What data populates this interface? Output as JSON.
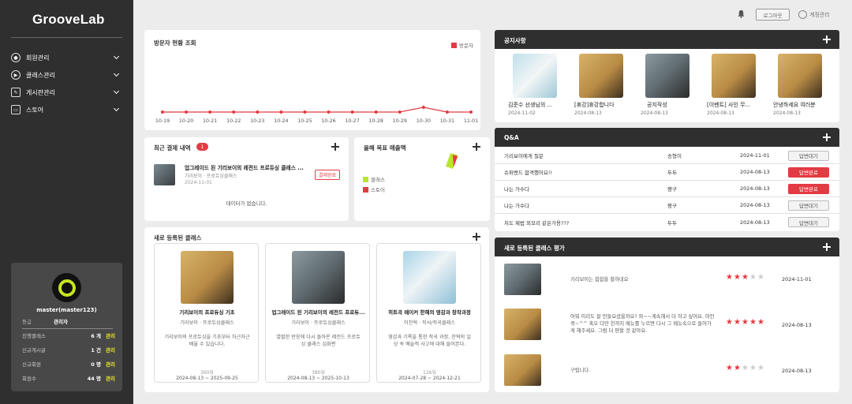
{
  "brand": {
    "logo": "GrooveLab"
  },
  "sidebar": {
    "items": [
      {
        "label": "회원관리",
        "icon": "user-icon"
      },
      {
        "label": "클래스관리",
        "icon": "play-icon"
      },
      {
        "label": "게시판관리",
        "icon": "edit-icon"
      },
      {
        "label": "스토어",
        "icon": "store-icon"
      }
    ],
    "profile": {
      "name": "master(master123)",
      "grade_label": "등급",
      "grade_value": "관리자",
      "stats": [
        {
          "label": "진행클래스",
          "value": "6 개",
          "link": "관리"
        },
        {
          "label": "신규게시글",
          "value": "1 건",
          "link": "관리"
        },
        {
          "label": "신규회원",
          "value": "0 명",
          "link": "관리"
        },
        {
          "label": "회원수",
          "value": "44 명",
          "link": "관리"
        }
      ]
    }
  },
  "topbar": {
    "logout": "로그아웃",
    "account": "계정관리"
  },
  "visitors": {
    "title": "방문자 현황 조회",
    "legend": "방문자",
    "chart_data": {
      "type": "line",
      "categories": [
        "10-19",
        "10-20",
        "10-21",
        "10-22",
        "10-23",
        "10-24",
        "10-25",
        "10-26",
        "10-27",
        "10-28",
        "10-29",
        "10-30",
        "10-31",
        "11-01"
      ],
      "series": [
        {
          "name": "방문자",
          "values": [
            1,
            1,
            1,
            1,
            1,
            1,
            1,
            1,
            1,
            1,
            1,
            2,
            1,
            1
          ]
        }
      ],
      "ylim": [
        0,
        10
      ],
      "grid": false,
      "legend_position": "top-right"
    }
  },
  "payments": {
    "title": "최근 결제 내역",
    "count": "1",
    "item": {
      "title": "업그레이드 된 기리보이의 레전드 프로듀싱 클래스 ...",
      "sub": "기리보이 · 프로듀싱클래스",
      "date": "2024-11-01",
      "status": "결제완료"
    },
    "empty": "데이터가 없습니다."
  },
  "target": {
    "title": "올해 목표 매출액",
    "legend": [
      "클래스",
      "스토어"
    ],
    "colors": {
      "class": "#b7e62b",
      "store": "#e23b44"
    }
  },
  "new_classes": {
    "title": "새로 등록된 클래스",
    "items": [
      {
        "title": "기리보이의 프로듀싱 기초",
        "author": "기리보이 · 프로듀싱클래스",
        "desc": "기리보이의 프로듀싱을 기초부터 차근차근 배울 수 있습니다.",
        "views": "360뷰",
        "period": "2024-08-13 ~ 2025-09-25"
      },
      {
        "title": "업그레이드 된 기리보이의 레전드 프로듀...",
        "author": "기리보이 · 프로듀싱클래스",
        "desc": "열렬한 반응에 다시 돌아온 레전드 프로듀싱 클래스 심화편",
        "views": "380뷰",
        "period": "2024-08-13 ~ 2025-10-13"
      },
      {
        "title": "히트곡 메이커 한해의 영감과 창작과정",
        "author": "이찬혁 · 작사/작곡클래스",
        "desc": "영감과 기록을 통한 작곡 과정, 찬혁의 일상 속 예술적 사고에 대해 들어본다.",
        "views": "126뷰",
        "period": "2024-07-28 ~ 2024-12-21"
      }
    ]
  },
  "notices": {
    "title": "공지사항",
    "items": [
      {
        "title": "김준수 선생님의 ...",
        "date": "2024-11-02"
      },
      {
        "title": "[휴강]휴강합니다",
        "date": "2024-08-13"
      },
      {
        "title": "공지작성",
        "date": "2024-08-13"
      },
      {
        "title": "[이벤트] 사인 무...",
        "date": "2024-08-13"
      },
      {
        "title": "안녕하세요 여러분",
        "date": "2024-08-13"
      }
    ]
  },
  "qa": {
    "title": "Q&A",
    "rows": [
      {
        "question": "기리보이에게 질문",
        "author": "송형이",
        "date": "2024-11-01",
        "status": "답변대기",
        "done": false
      },
      {
        "question": "슈퍼밴드 합격했어요!!",
        "author": "두두",
        "date": "2024-08-13",
        "status": "답변완료",
        "done": true
      },
      {
        "question": "나는 가수다",
        "author": "쨩구",
        "date": "2024-08-13",
        "status": "답변완료",
        "done": true
      },
      {
        "question": "나는 가수다",
        "author": "짱구",
        "date": "2024-08-13",
        "status": "답변대기",
        "done": false
      },
      {
        "question": "처도 제법 외모리 같은가용???",
        "author": "두두",
        "date": "2024-08-13",
        "status": "답변대기",
        "done": false
      }
    ]
  },
  "reviews": {
    "title": "새로 등록된 클래스 평가",
    "rows": [
      {
        "text": "기리보이는 힙합을 찰하네요",
        "rating": 3,
        "date": "2024-11-01"
      },
      {
        "text": "어뭐 이리도 잘 만들요셨을까요? 와~~계속해서 더 하고 싶어요. 마인쿡~^^ 혹오 다만 한까지 메뉴를 누르면 다시 그 메뉴속으로 들어가게 해주세요. 그럼 더 편할 것 같아요.",
        "rating": 5,
        "date": "2024-08-13"
      },
      {
        "text": "구립니다.",
        "rating": 2,
        "date": "2024-08-13"
      }
    ]
  }
}
